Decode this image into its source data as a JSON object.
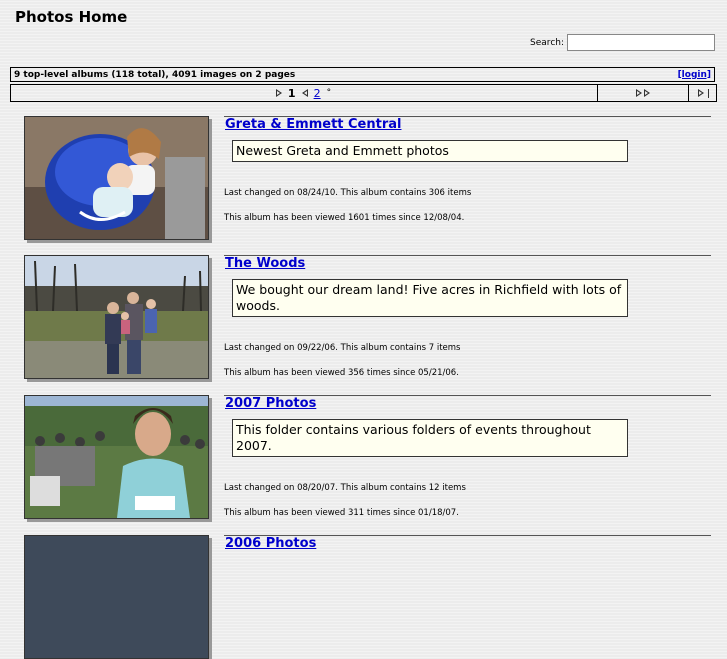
{
  "header": {
    "title": "Photos Home",
    "search_label": "Search:",
    "search_value": ""
  },
  "summary": {
    "text": "9 top-level albums (118 total), 4091 images on 2 pages",
    "login_label": "[login]"
  },
  "pager": {
    "current_page": "1",
    "next_page": "2",
    "dot": "°"
  },
  "albums": [
    {
      "title": "Greta & Emmett Central",
      "description": "Newest Greta and Emmett photos",
      "changed": "Last changed on 08/24/10.  This album contains 306 items",
      "views": "This album has been viewed 1601 times since 12/08/04."
    },
    {
      "title": "The Woods",
      "description": "We bought our dream land! Five acres in Richfield with lots of woods.",
      "changed": "Last changed on 09/22/06.  This album contains 7 items",
      "views": "This album has been viewed 356 times since 05/21/06."
    },
    {
      "title": "2007 Photos",
      "description": "This folder contains various folders of events throughout 2007.",
      "changed": "Last changed on 08/20/07.  This album contains 12 items",
      "views": "This album has been viewed 311 times since 01/18/07."
    },
    {
      "title": "2006 Photos"
    }
  ],
  "colors": {
    "link": "#0000cc",
    "description_bg": "#fffff0",
    "page_bg": "#ececec"
  }
}
